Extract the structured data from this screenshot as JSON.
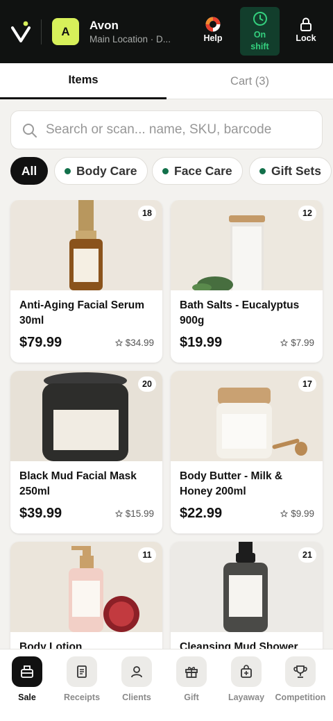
{
  "header": {
    "store_initial": "A",
    "store_name": "Avon",
    "store_location": "Main Location · D...",
    "help_label": "Help",
    "shift_label_1": "On",
    "shift_label_2": "shift",
    "lock_label": "Lock"
  },
  "tabs": [
    {
      "label": "Items",
      "active": true
    },
    {
      "label": "Cart (3)",
      "active": false
    }
  ],
  "search": {
    "placeholder": "Search or scan... name, SKU, barcode",
    "value": ""
  },
  "categories": [
    {
      "label": "All",
      "active": true
    },
    {
      "label": "Body Care",
      "active": false
    },
    {
      "label": "Face Care",
      "active": false
    },
    {
      "label": "Gift Sets",
      "active": false
    }
  ],
  "products": [
    {
      "name": "Anti-Aging Facial Serum 30ml",
      "price": "$79.99",
      "cost": "$34.99",
      "stock": "18"
    },
    {
      "name": "Bath Salts - Eucalyptus 900g",
      "price": "$19.99",
      "cost": "$7.99",
      "stock": "12"
    },
    {
      "name": "Black Mud Facial Mask 250ml",
      "price": "$39.99",
      "cost": "$15.99",
      "stock": "20"
    },
    {
      "name": "Body Butter - Milk & Honey 200ml",
      "price": "$22.99",
      "cost": "$9.99",
      "stock": "17"
    },
    {
      "name": "Body Lotion",
      "price": "",
      "cost": "",
      "stock": "11"
    },
    {
      "name": "Cleansing Mud Shower",
      "price": "",
      "cost": "",
      "stock": "21"
    }
  ],
  "bottom_nav": [
    {
      "label": "Sale",
      "icon": "register-icon",
      "active": true
    },
    {
      "label": "Receipts",
      "icon": "receipt-icon",
      "active": false
    },
    {
      "label": "Clients",
      "icon": "person-icon",
      "active": false
    },
    {
      "label": "Gift",
      "icon": "gift-icon",
      "active": false
    },
    {
      "label": "Layaway",
      "icon": "layaway-bag-icon",
      "active": false
    },
    {
      "label": "Competition",
      "icon": "trophy-icon",
      "active": false
    }
  ],
  "colors": {
    "topbar": "#101211",
    "brand_accent": "#d7f05a",
    "shift_green": "#34d07e",
    "category_dot": "#12704a"
  }
}
